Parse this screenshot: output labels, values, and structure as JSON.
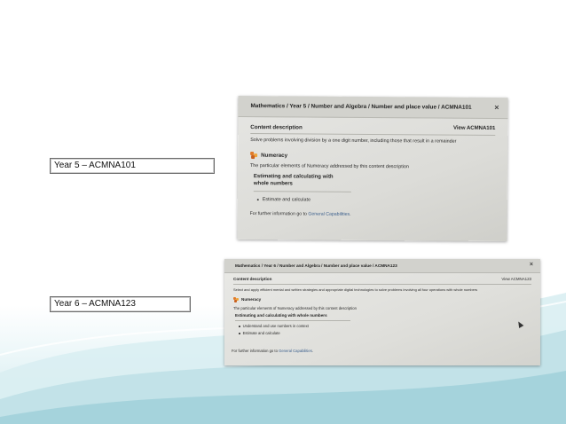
{
  "slide": {
    "colors": {
      "teal_light": "#d9eef2",
      "teal_mid": "#b9dde4",
      "teal_dark": "#8ec7d2"
    }
  },
  "labels": [
    {
      "text": "Year 5 – ACMNA101"
    },
    {
      "text": "Year 6 – ACMNA123"
    }
  ],
  "screenshot_year5": {
    "breadcrumb": "Mathematics / Year 5 / Number and Algebra / Number and place value / ACMNA101",
    "close_glyph": "×",
    "content_heading": "Content description",
    "view_link": "View ACMNA101",
    "description": "Solve problems involving division by a one digit number, including those that result in a remainder",
    "numeracy_title": "Numeracy",
    "numeracy_text": "The particular elements of Numeracy addressed by this content description",
    "subheading_line1": "Estimating and calculating with",
    "subheading_line2": "whole numbers",
    "bullets": [
      "Estimate and calculate"
    ],
    "further_prefix": "For further information go to ",
    "further_link": "General Capabilities",
    "further_suffix": "."
  },
  "screenshot_year6": {
    "breadcrumb": "Mathematics / Year 6 / Number and Algebra / Number and place value / ACMNA123",
    "close_glyph": "×",
    "content_heading": "Content description",
    "view_link": "View ACMNA123",
    "description": "Select and apply efficient mental and written strategies and appropriate digital technologies to solve problems involving all four operations with whole numbers",
    "numeracy_title": "Numeracy",
    "numeracy_text": "The particular elements of Numeracy addressed by this content description",
    "subheading": "Estimating and calculating with whole numbers",
    "bullets": [
      "Understand and use numbers in context",
      "Estimate and calculate"
    ],
    "further_prefix": "For further information go to ",
    "further_link": "General Capabilities",
    "further_suffix": "."
  }
}
